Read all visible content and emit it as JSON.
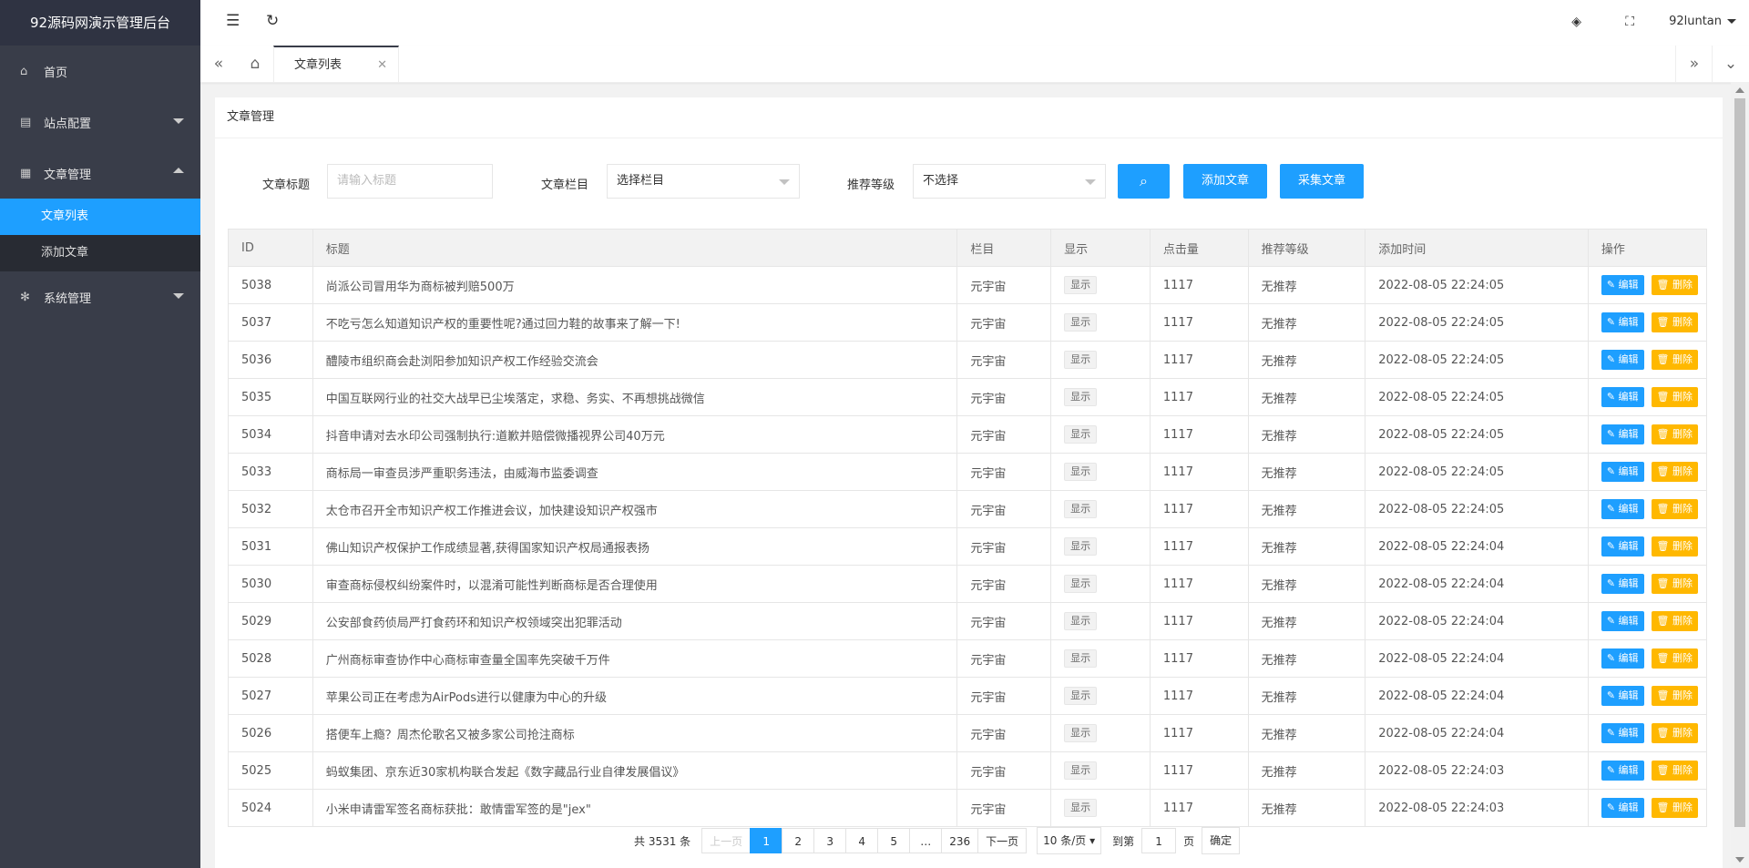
{
  "app": {
    "title": "92源码网演示管理后台"
  },
  "sidebar": {
    "items": [
      {
        "label": "首页",
        "icon": "home-icon"
      },
      {
        "label": "站点配置",
        "icon": "config-icon"
      },
      {
        "label": "文章管理",
        "icon": "article-icon"
      },
      {
        "label": "系统管理",
        "icon": "gear-icon"
      }
    ],
    "sub": [
      {
        "label": "文章列表"
      },
      {
        "label": "添加文章"
      }
    ]
  },
  "header": {
    "user": "92luntan"
  },
  "tabs": {
    "active_label": "文章列表"
  },
  "page": {
    "card_title": "文章管理",
    "form": {
      "title_label": "文章标题",
      "title_placeholder": "请输入标题",
      "column_label": "文章栏目",
      "column_value": "选择栏目",
      "level_label": "推荐等级",
      "level_value": "不选择",
      "add_button": "添加文章",
      "collect_button": "采集文章"
    },
    "table": {
      "headers": [
        "ID",
        "标题",
        "栏目",
        "显示",
        "点击量",
        "推荐等级",
        "添加时间",
        "操作"
      ],
      "edit_label": "编辑",
      "delete_label": "删除",
      "rows": [
        {
          "id": "5038",
          "title": "尚派公司冒用华为商标被判赔500万",
          "col": "元宇宙",
          "show": "显示",
          "clicks": "1117",
          "level": "无推荐",
          "time": "2022-08-05 22:24:05"
        },
        {
          "id": "5037",
          "title": "不吃亏怎么知道知识产权的重要性呢?通过回力鞋的故事来了解一下!",
          "col": "元宇宙",
          "show": "显示",
          "clicks": "1117",
          "level": "无推荐",
          "time": "2022-08-05 22:24:05"
        },
        {
          "id": "5036",
          "title": "醴陵市组织商会赴浏阳参加知识产权工作经验交流会",
          "col": "元宇宙",
          "show": "显示",
          "clicks": "1117",
          "level": "无推荐",
          "time": "2022-08-05 22:24:05"
        },
        {
          "id": "5035",
          "title": "中国互联网行业的社交大战早已尘埃落定，求稳、务实、不再想挑战微信",
          "col": "元宇宙",
          "show": "显示",
          "clicks": "1117",
          "level": "无推荐",
          "time": "2022-08-05 22:24:05"
        },
        {
          "id": "5034",
          "title": "抖音申请对去水印公司强制执行:道歉并赔偿微播视界公司40万元",
          "col": "元宇宙",
          "show": "显示",
          "clicks": "1117",
          "level": "无推荐",
          "time": "2022-08-05 22:24:05"
        },
        {
          "id": "5033",
          "title": "商标局一审查员涉严重职务违法，由威海市监委调查",
          "col": "元宇宙",
          "show": "显示",
          "clicks": "1117",
          "level": "无推荐",
          "time": "2022-08-05 22:24:05"
        },
        {
          "id": "5032",
          "title": "太仓市召开全市知识产权工作推进会议，加快建设知识产权强市",
          "col": "元宇宙",
          "show": "显示",
          "clicks": "1117",
          "level": "无推荐",
          "time": "2022-08-05 22:24:05"
        },
        {
          "id": "5031",
          "title": "佛山知识产权保护工作成绩显著,获得国家知识产权局通报表扬",
          "col": "元宇宙",
          "show": "显示",
          "clicks": "1117",
          "level": "无推荐",
          "time": "2022-08-05 22:24:04"
        },
        {
          "id": "5030",
          "title": "审查商标侵权纠纷案件时，以混淆可能性判断商标是否合理使用",
          "col": "元宇宙",
          "show": "显示",
          "clicks": "1117",
          "level": "无推荐",
          "time": "2022-08-05 22:24:04"
        },
        {
          "id": "5029",
          "title": "公安部食药侦局严打食药环和知识产权领域突出犯罪活动",
          "col": "元宇宙",
          "show": "显示",
          "clicks": "1117",
          "level": "无推荐",
          "time": "2022-08-05 22:24:04"
        },
        {
          "id": "5028",
          "title": "广州商标审查协作中心商标审查量全国率先突破千万件",
          "col": "元宇宙",
          "show": "显示",
          "clicks": "1117",
          "level": "无推荐",
          "time": "2022-08-05 22:24:04"
        },
        {
          "id": "5027",
          "title": "苹果公司正在考虑为AirPods进行以健康为中心的升级",
          "col": "元宇宙",
          "show": "显示",
          "clicks": "1117",
          "level": "无推荐",
          "time": "2022-08-05 22:24:04"
        },
        {
          "id": "5026",
          "title": "搭便车上瘾？周杰伦歌名又被多家公司抢注商标",
          "col": "元宇宙",
          "show": "显示",
          "clicks": "1117",
          "level": "无推荐",
          "time": "2022-08-05 22:24:04"
        },
        {
          "id": "5025",
          "title": "蚂蚁集团、京东近30家机构联合发起《数字藏品行业自律发展倡议》",
          "col": "元宇宙",
          "show": "显示",
          "clicks": "1117",
          "level": "无推荐",
          "time": "2022-08-05 22:24:03"
        },
        {
          "id": "5024",
          "title": "小米申请雷军签名商标获批：敢情雷军签的是\"jex\"",
          "col": "元宇宙",
          "show": "显示",
          "clicks": "1117",
          "level": "无推荐",
          "time": "2022-08-05 22:24:03"
        }
      ]
    },
    "pager": {
      "count": "共 3531 条",
      "prev": "上一页",
      "pages": [
        "1",
        "2",
        "3",
        "4",
        "5",
        "…",
        "236"
      ],
      "current": "1",
      "next": "下一页",
      "per_page": "10 条/页",
      "goto_label": "到第",
      "goto_value": "1",
      "page_unit": "页",
      "ok": "确定"
    }
  }
}
